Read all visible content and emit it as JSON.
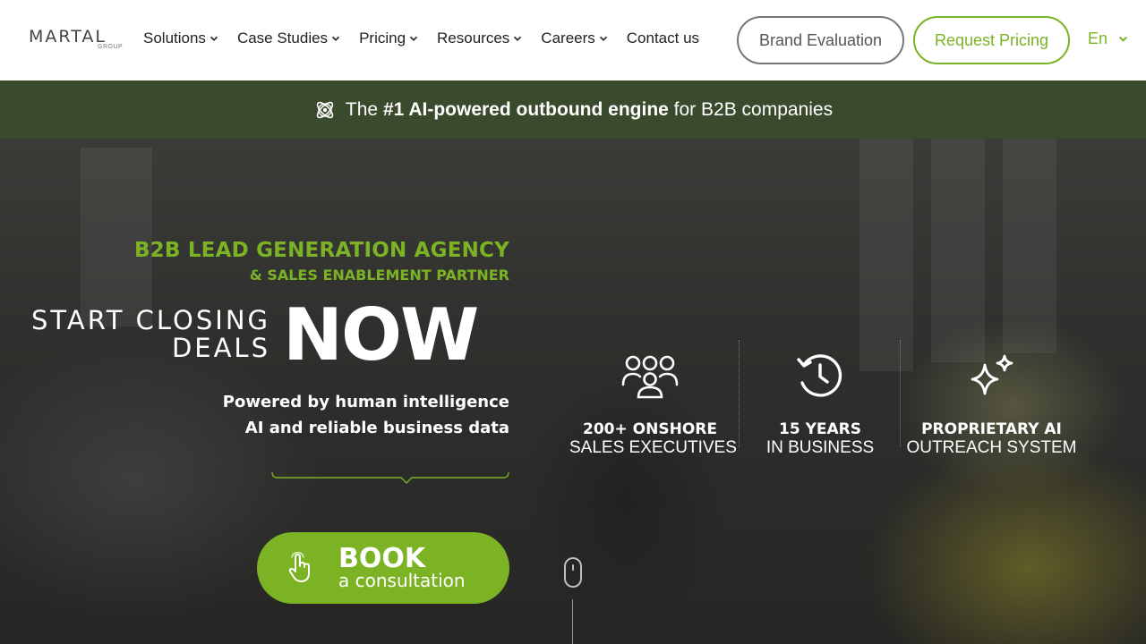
{
  "header": {
    "logo_text": "MARTAL",
    "logo_sub": "GROUP",
    "nav": [
      {
        "label": "Solutions",
        "has_dropdown": true
      },
      {
        "label": "Case Studies",
        "has_dropdown": true
      },
      {
        "label": "Pricing",
        "has_dropdown": true
      },
      {
        "label": "Resources",
        "has_dropdown": true
      },
      {
        "label": "Careers",
        "has_dropdown": true
      },
      {
        "label": "Contact us",
        "has_dropdown": false
      }
    ],
    "brand_evaluation_label": "Brand Evaluation",
    "request_pricing_label": "Request Pricing",
    "language": "En"
  },
  "banner": {
    "prefix": "The ",
    "bold": "#1 AI-powered outbound engine",
    "suffix": " for B2B companies",
    "icon": "atom-icon"
  },
  "hero": {
    "eyebrow_line1": "B2B LEAD GENERATION AGENCY",
    "eyebrow_line2": "& SALES ENABLEMENT PARTNER",
    "start_line1": "START CLOSING",
    "start_line2": "DEALS",
    "now": "NOW",
    "powered_line1": "Powered by human intelligence",
    "powered_line2": "AI and reliable business data",
    "cta_main": "BOOK",
    "cta_sub": "a consultation"
  },
  "stats": [
    {
      "icon": "team-icon",
      "line1": "200+ ONSHORE",
      "line2": "SALES EXECUTIVES"
    },
    {
      "icon": "history-clock-icon",
      "line1": "15 YEARS",
      "line2": "IN BUSINESS"
    },
    {
      "icon": "sparkles-icon",
      "line1": "PROPRIETARY AI",
      "line2": "OUTREACH SYSTEM"
    }
  ],
  "colors": {
    "accent": "#7cb324",
    "banner_bg": "#3a4a2c",
    "header_bg": "#ffffff"
  }
}
